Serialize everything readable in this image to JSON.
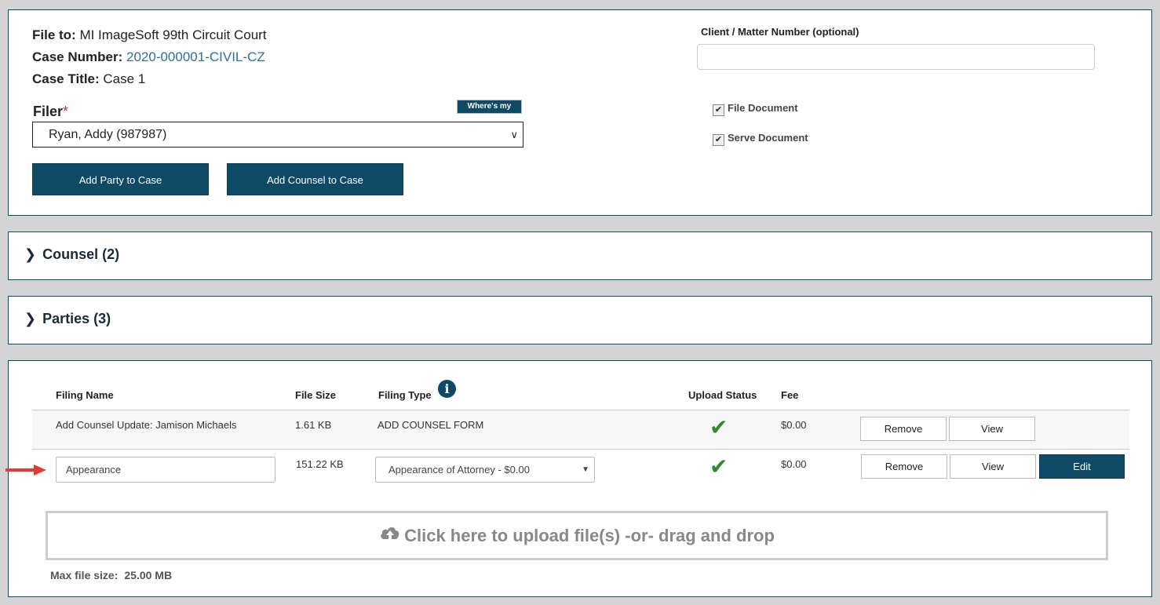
{
  "case": {
    "file_to_label": "File to:",
    "file_to_value": "MI ImageSoft 99th Circuit Court",
    "case_number_label": "Case Number:",
    "case_number_value": "2020-000001-CIVIL-CZ",
    "case_title_label": "Case Title:",
    "case_title_value": "Case 1",
    "filer_label": "Filer",
    "filer_required": "*",
    "wheres_filer": "Where's my filer?",
    "filer_selected": "Ryan, Addy (987987)",
    "add_party_label": "Add Party to Case",
    "add_counsel_label": "Add Counsel to Case",
    "client_matter_label": "Client / Matter Number (optional)",
    "client_matter_value": "",
    "file_document_label": "File Document",
    "serve_document_label": "Serve Document"
  },
  "accordions": {
    "counsel": "Counsel (2)",
    "parties": "Parties (3)"
  },
  "filings": {
    "headers": {
      "name": "Filing Name",
      "size": "File Size",
      "type": "Filing Type",
      "status": "Upload Status",
      "fee": "Fee"
    },
    "rows": [
      {
        "name": "Add Counsel Update: Jamison Michaels",
        "size": "1.61 KB",
        "type": "ADD COUNSEL FORM",
        "fee": "$0.00",
        "remove": "Remove",
        "view": "View"
      },
      {
        "name": "Appearance",
        "size": "151.22 KB",
        "type": "Appearance of Attorney - $0.00",
        "fee": "$0.00",
        "remove": "Remove",
        "view": "View",
        "edit": "Edit"
      }
    ],
    "upload_text": "Click here to upload file(s) -or- drag and drop",
    "max_size_label": "Max file size:",
    "max_size_value": "25.00 MB"
  },
  "colors": {
    "primary": "#0e4a66",
    "success": "#2e8b2e",
    "pointer_arrow": "#e53935"
  }
}
